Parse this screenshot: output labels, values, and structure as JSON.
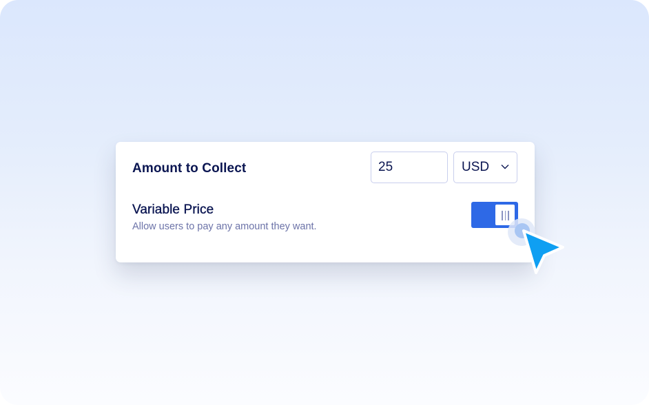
{
  "payment_field": {
    "amount_label": "Amount to Collect",
    "amount_value": "25",
    "currency_value": "USD",
    "variable_price_label": "Variable Price",
    "variable_price_description": "Allow users to pay any amount they want.",
    "variable_price_enabled": true
  },
  "colors": {
    "accent": "#2e69e6",
    "text_primary": "#0a1551",
    "text_secondary": "#6c73a8",
    "cursor": "#0f9ff2"
  },
  "icons": {
    "currency_dropdown": "chevron-down-icon",
    "cursor": "mouse-pointer-icon"
  }
}
